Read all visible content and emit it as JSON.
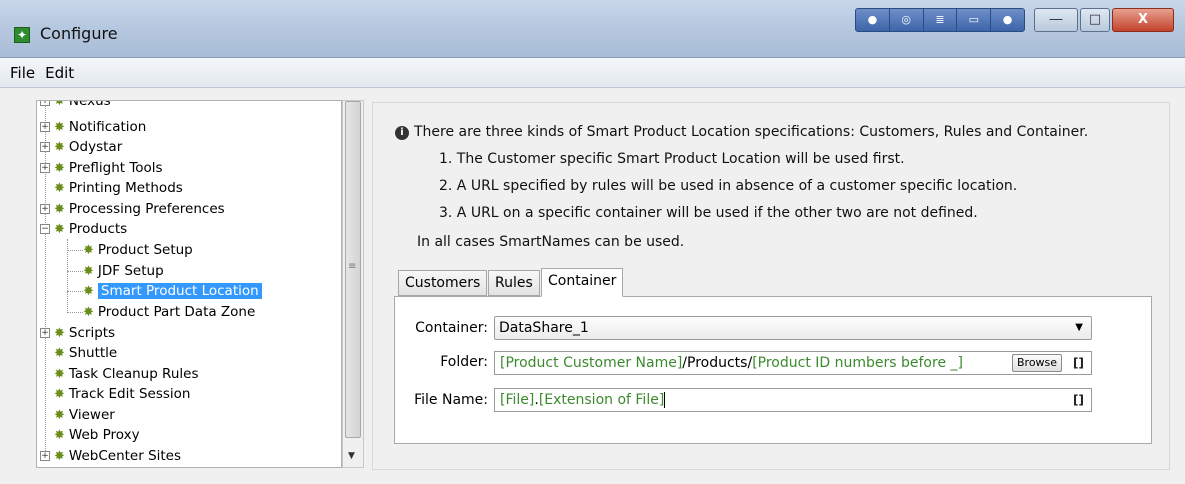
{
  "window": {
    "title": "Configure",
    "app_icon": "✦",
    "toolbar_icons": [
      "●",
      "◎",
      "≣",
      "▭",
      "●"
    ],
    "minimize": "―",
    "maximize": "□",
    "close": "X"
  },
  "menubar": {
    "items": [
      "File",
      "Edit"
    ]
  },
  "tree": {
    "items": [
      {
        "label": "Nexus",
        "has_expander": true
      },
      {
        "label": "Notification",
        "has_expander": true
      },
      {
        "label": "Odystar",
        "has_expander": true
      },
      {
        "label": "Preflight Tools",
        "has_expander": true
      },
      {
        "label": "Printing Methods",
        "has_expander": false
      },
      {
        "label": "Processing Preferences",
        "has_expander": true
      },
      {
        "label": "Products",
        "has_expander": true,
        "expanded": true
      },
      {
        "label": "Product Setup",
        "child": true
      },
      {
        "label": "JDF Setup",
        "child": true
      },
      {
        "label": "Smart Product Location",
        "child": true,
        "selected": true
      },
      {
        "label": "Product Part Data Zone",
        "child": true
      },
      {
        "label": "Scripts",
        "has_expander": true
      },
      {
        "label": "Shuttle",
        "has_expander": false
      },
      {
        "label": "Task Cleanup Rules",
        "has_expander": false
      },
      {
        "label": "Track Edit Session",
        "has_expander": false
      },
      {
        "label": "Viewer",
        "has_expander": false
      },
      {
        "label": "Web Proxy",
        "has_expander": false
      },
      {
        "label": "WebCenter Sites",
        "has_expander": true
      }
    ]
  },
  "info": {
    "icon": "i",
    "intro": "There are three kinds of Smart Product Location specifications: Customers, Rules and Container.",
    "points": [
      "1. The Customer specific Smart Product Location will be used first.",
      "2. A URL specified by rules will be used in absence of a customer specific location.",
      "3. A URL on a specific container will be used if the other two are not defined."
    ],
    "footer": "In all cases SmartNames can be used."
  },
  "tabs": [
    "Customers",
    "Rules",
    "Container"
  ],
  "active_tab": "Container",
  "form": {
    "container_label": "Container:",
    "container_value": "DataShare_1",
    "folder_label": "Folder:",
    "folder_parts": [
      "[Product Customer Name]",
      "/Products/",
      "[Product ID numbers before _]"
    ],
    "browse_label": "Browse",
    "file_name_label": "File Name:",
    "file_name_parts": [
      "[File]",
      ".",
      "[Extension of File]"
    ],
    "smartname_button": "[]"
  },
  "colors": {
    "selection": "#3399ff",
    "smartname": "#3c8a2e"
  }
}
